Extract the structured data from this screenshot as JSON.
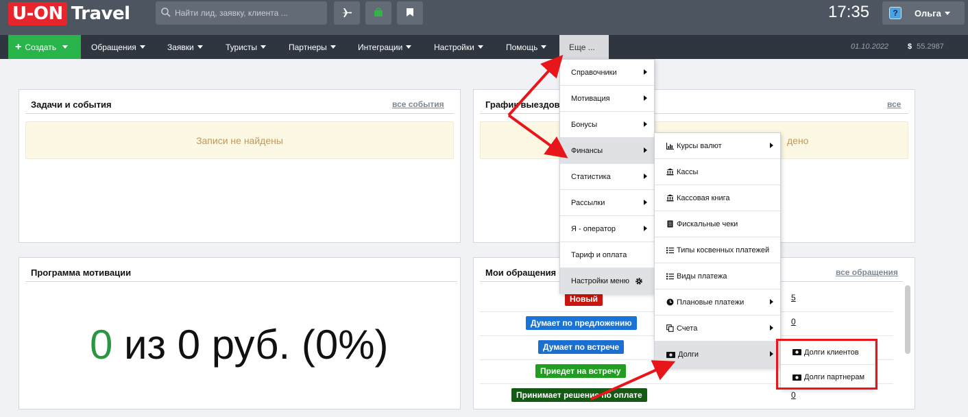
{
  "header": {
    "logo_uon": "U-ON",
    "logo_travel": "Travel",
    "search_placeholder": "Найти лид, заявку, клиента ...",
    "time": "17:35",
    "user_icon_text": "?",
    "user_name": "Ольга",
    "buttons": [
      "plane-icon",
      "briefcase-icon",
      "bookmark-icon"
    ]
  },
  "nav": {
    "create": "Создать",
    "items": [
      "Обращения",
      "Заявки",
      "Туристы",
      "Партнеры",
      "Интеграции",
      "Настройки",
      "Помощь"
    ],
    "more": "Еще ...",
    "date": "01.10.2022",
    "rate_symbol": "$",
    "rate": "55.2987"
  },
  "tasks_panel": {
    "title": "Задачи и события",
    "link": "все события",
    "empty": "Записи не найдены"
  },
  "schedule_panel": {
    "title": "Графи",
    "title_tail": "к выездов",
    "link": "все",
    "empty_tail": "дено"
  },
  "motivation_panel": {
    "title": "Программа мотивации",
    "value": "0",
    "text": " из 0 руб. (0%)"
  },
  "requests_panel": {
    "title": "Мои обращения",
    "link": "все обращения",
    "rows": [
      {
        "label": "Новый",
        "color": "#c9160e",
        "count": "5"
      },
      {
        "label": "Думает по предложению",
        "color": "#1a73d6",
        "count": "0"
      },
      {
        "label": "Думает по встрече",
        "color": "#1a6fcf",
        "count": ""
      },
      {
        "label": "Приедет на встречу",
        "color": "#1f9e1f",
        "count": ""
      },
      {
        "label": "Принимает решение по оплате",
        "color": "#145a14",
        "count": "0"
      }
    ]
  },
  "more_menu": {
    "items": [
      {
        "label": "Справочники",
        "arrow": true
      },
      {
        "label": "Мотивация",
        "arrow": true
      },
      {
        "label": "Бонусы",
        "arrow": true
      },
      {
        "label": "Финансы",
        "arrow": true
      },
      {
        "label": "Статистика",
        "arrow": true
      },
      {
        "label": "Рассылки",
        "arrow": true
      },
      {
        "label": "Я - оператор",
        "arrow": true
      },
      {
        "label": "Тариф и оплата",
        "arrow": false
      },
      {
        "label": "Настройки меню",
        "arrow": false
      }
    ]
  },
  "finance_menu": {
    "items": [
      {
        "label": "Курсы валют",
        "icon": "chart-icon",
        "arrow": true
      },
      {
        "label": "Кассы",
        "icon": "bank-icon",
        "arrow": false
      },
      {
        "label": "Кассовая книга",
        "icon": "bank-icon",
        "arrow": false
      },
      {
        "label": "Фискальные чеки",
        "icon": "receipt-icon",
        "arrow": false
      },
      {
        "label": "Типы косвенных платежей",
        "icon": "list-icon",
        "arrow": false
      },
      {
        "label": "Виды платежа",
        "icon": "list-icon",
        "arrow": false
      },
      {
        "label": "Плановые платежи",
        "icon": "clock-icon",
        "arrow": true
      },
      {
        "label": "Счета",
        "icon": "copy-icon",
        "arrow": true
      },
      {
        "label": "Долги",
        "icon": "money-icon",
        "arrow": true
      }
    ]
  },
  "debts_menu": {
    "items": [
      {
        "label": "Долги клиентов",
        "icon": "money-icon"
      },
      {
        "label": "Долги партнерам",
        "icon": "money-icon"
      }
    ]
  },
  "colors": {
    "topbar": "#4d5561",
    "navbar": "#2f3640",
    "create": "#28b44a",
    "highlight": "#e8161b"
  }
}
